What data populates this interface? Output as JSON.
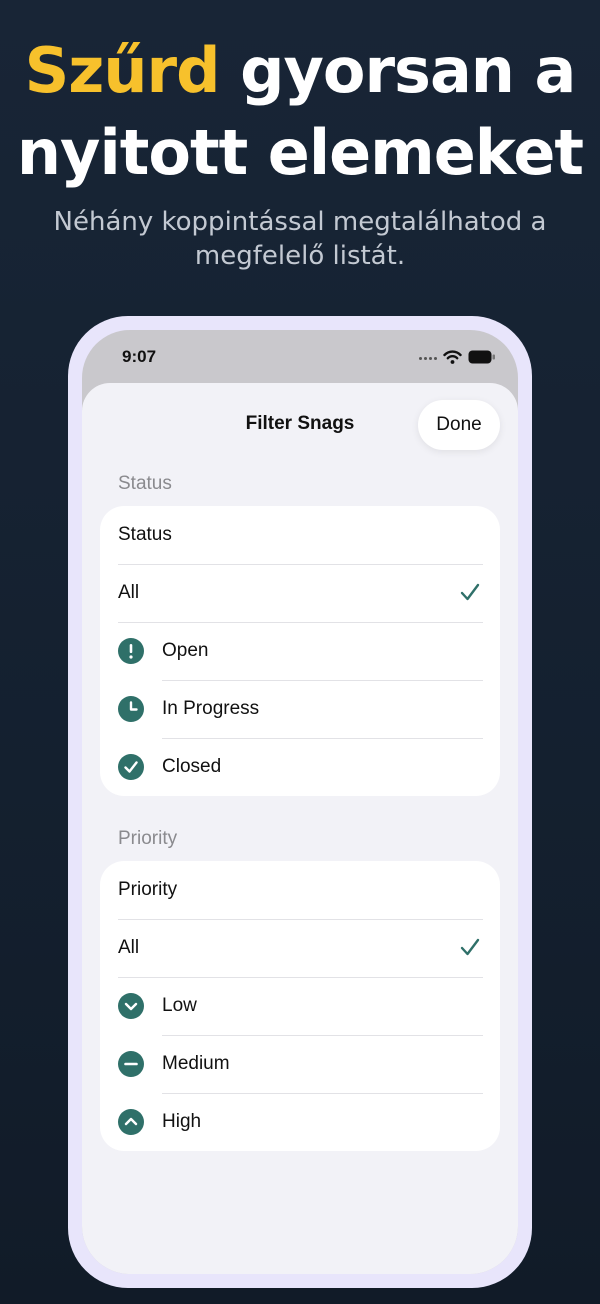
{
  "promo": {
    "headline_accent": "Szűrd",
    "headline_rest_line1": " gyorsan a",
    "headline_line2": "nyitott elemeket",
    "subheadline_line1": "Néhány koppintással megtalálhatod a",
    "subheadline_line2": "megfelelő listát."
  },
  "status_bar": {
    "time": "9:07"
  },
  "sheet": {
    "title": "Filter Snags",
    "done_label": "Done"
  },
  "status_section": {
    "header": "Status",
    "picker_label": "Status",
    "options": [
      {
        "label": "All",
        "icon": "checkmark-icon",
        "selected": true
      },
      {
        "label": "Open",
        "icon": "exclamation-circle-icon"
      },
      {
        "label": "In Progress",
        "icon": "clock-circle-icon"
      },
      {
        "label": "Closed",
        "icon": "checkmark-circle-icon"
      }
    ]
  },
  "priority_section": {
    "header": "Priority",
    "picker_label": "Priority",
    "options": [
      {
        "label": "All",
        "icon": "checkmark-icon",
        "selected": true
      },
      {
        "label": "Low",
        "icon": "chevron-down-circle-icon"
      },
      {
        "label": "Medium",
        "icon": "minus-circle-icon"
      },
      {
        "label": "High",
        "icon": "chevron-up-circle-icon"
      }
    ]
  },
  "colors": {
    "accent_yellow": "#f7c12c",
    "icon_teal": "#2f7069",
    "phone_frame": "#e8e5fb"
  }
}
